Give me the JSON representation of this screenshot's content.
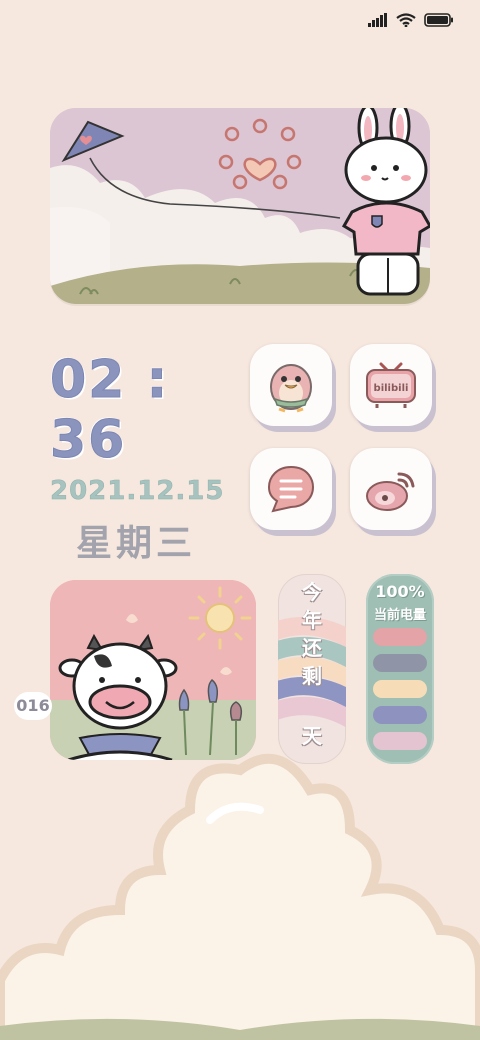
{
  "status_bar": {
    "icons": [
      "signal-icon",
      "wifi-icon",
      "battery-icon"
    ]
  },
  "hero_widget": {
    "illustration": "bunny flying a kite"
  },
  "clock": {
    "time": "02 : 36",
    "date": "2021.12.15",
    "weekday": "星期三"
  },
  "apps": [
    {
      "name": "qq-app",
      "icon": "penguin-icon"
    },
    {
      "name": "bilibili-app",
      "icon": "bilibili-tv-icon",
      "logo_text": "bilibili"
    },
    {
      "name": "message-app",
      "icon": "message-bubble-icon"
    },
    {
      "name": "weibo-app",
      "icon": "weibo-icon"
    }
  ],
  "photo_widget": {
    "illustration": "smiling cow with tulips"
  },
  "year_widget": {
    "chars": [
      "今",
      "年",
      "还",
      "剩"
    ],
    "days_left": "016",
    "unit": "天"
  },
  "battery_widget": {
    "percent": "100%",
    "label": "当前电量",
    "bar_colors": [
      "#e3a3a7",
      "#8f95a6",
      "#f6ddb8",
      "#8e92bf",
      "#e3c4d0"
    ]
  },
  "colors": {
    "background": "#f6e8de",
    "accent_blue": "#8b94bd",
    "accent_green": "#9fbeb4"
  }
}
